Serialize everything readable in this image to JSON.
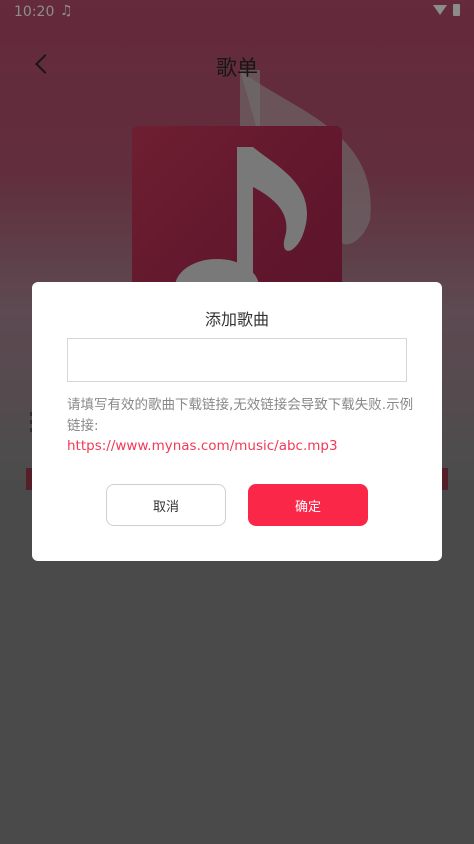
{
  "status_bar": {
    "time": "10:20",
    "music_icon": "music-note-icon",
    "wifi_icon": "wifi-icon",
    "battery_icon": "battery-icon"
  },
  "header": {
    "title": "歌单",
    "back_icon": "chevron-left-icon"
  },
  "dialog": {
    "title": "添加歌曲",
    "input_value": "",
    "hint": "请填写有效的歌曲下载链接,无效链接会导致下载失败.示例链接:",
    "example_url": "https://www.mynas.com/music/abc.mp3",
    "cancel_label": "取消",
    "confirm_label": "确定"
  },
  "colors": {
    "accent": "#fb2748",
    "link": "#f13a55",
    "overlay": "rgba(0,0,0,0.45)"
  }
}
